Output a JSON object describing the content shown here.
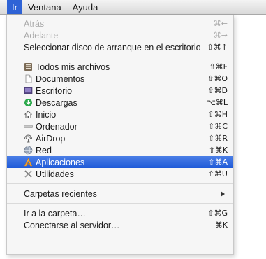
{
  "menubar": {
    "items": [
      {
        "label": "Ir"
      },
      {
        "label": "Ventana"
      },
      {
        "label": "Ayuda"
      }
    ]
  },
  "menu": {
    "group1": [
      {
        "label": "Atrás",
        "shortcut": "⌘←",
        "disabled": true
      },
      {
        "label": "Adelante",
        "shortcut": "⌘→",
        "disabled": true
      },
      {
        "label": "Seleccionar disco de arranque en el escritorio",
        "shortcut": "⇧⌘↑",
        "disabled": false
      }
    ],
    "group2": [
      {
        "label": "Todos mis archivos",
        "shortcut": "⇧⌘F",
        "icon": "all-files-icon"
      },
      {
        "label": "Documentos",
        "shortcut": "⇧⌘O",
        "icon": "documents-icon"
      },
      {
        "label": "Escritorio",
        "shortcut": "⇧⌘D",
        "icon": "desktop-icon"
      },
      {
        "label": "Descargas",
        "shortcut": "⌥⌘L",
        "icon": "downloads-icon"
      },
      {
        "label": "Inicio",
        "shortcut": "⇧⌘H",
        "icon": "home-icon"
      },
      {
        "label": "Ordenador",
        "shortcut": "⇧⌘C",
        "icon": "computer-icon"
      },
      {
        "label": "AirDrop",
        "shortcut": "⇧⌘R",
        "icon": "airdrop-icon"
      },
      {
        "label": "Red",
        "shortcut": "⇧⌘K",
        "icon": "network-icon"
      },
      {
        "label": "Aplicaciones",
        "shortcut": "⇧⌘A",
        "icon": "applications-icon",
        "highlighted": true
      },
      {
        "label": "Utilidades",
        "shortcut": "⇧⌘U",
        "icon": "utilities-icon"
      }
    ],
    "group3": [
      {
        "label": "Carpetas recientes",
        "has_submenu": true
      }
    ],
    "group4": [
      {
        "label": "Ir a la carpeta…",
        "shortcut": "⇧⌘G"
      },
      {
        "label": "Conectarse al servidor…",
        "shortcut": "⌘K"
      }
    ]
  },
  "colors": {
    "highlight": "#2f63d6",
    "disabled_text": "#a9a9a9"
  }
}
